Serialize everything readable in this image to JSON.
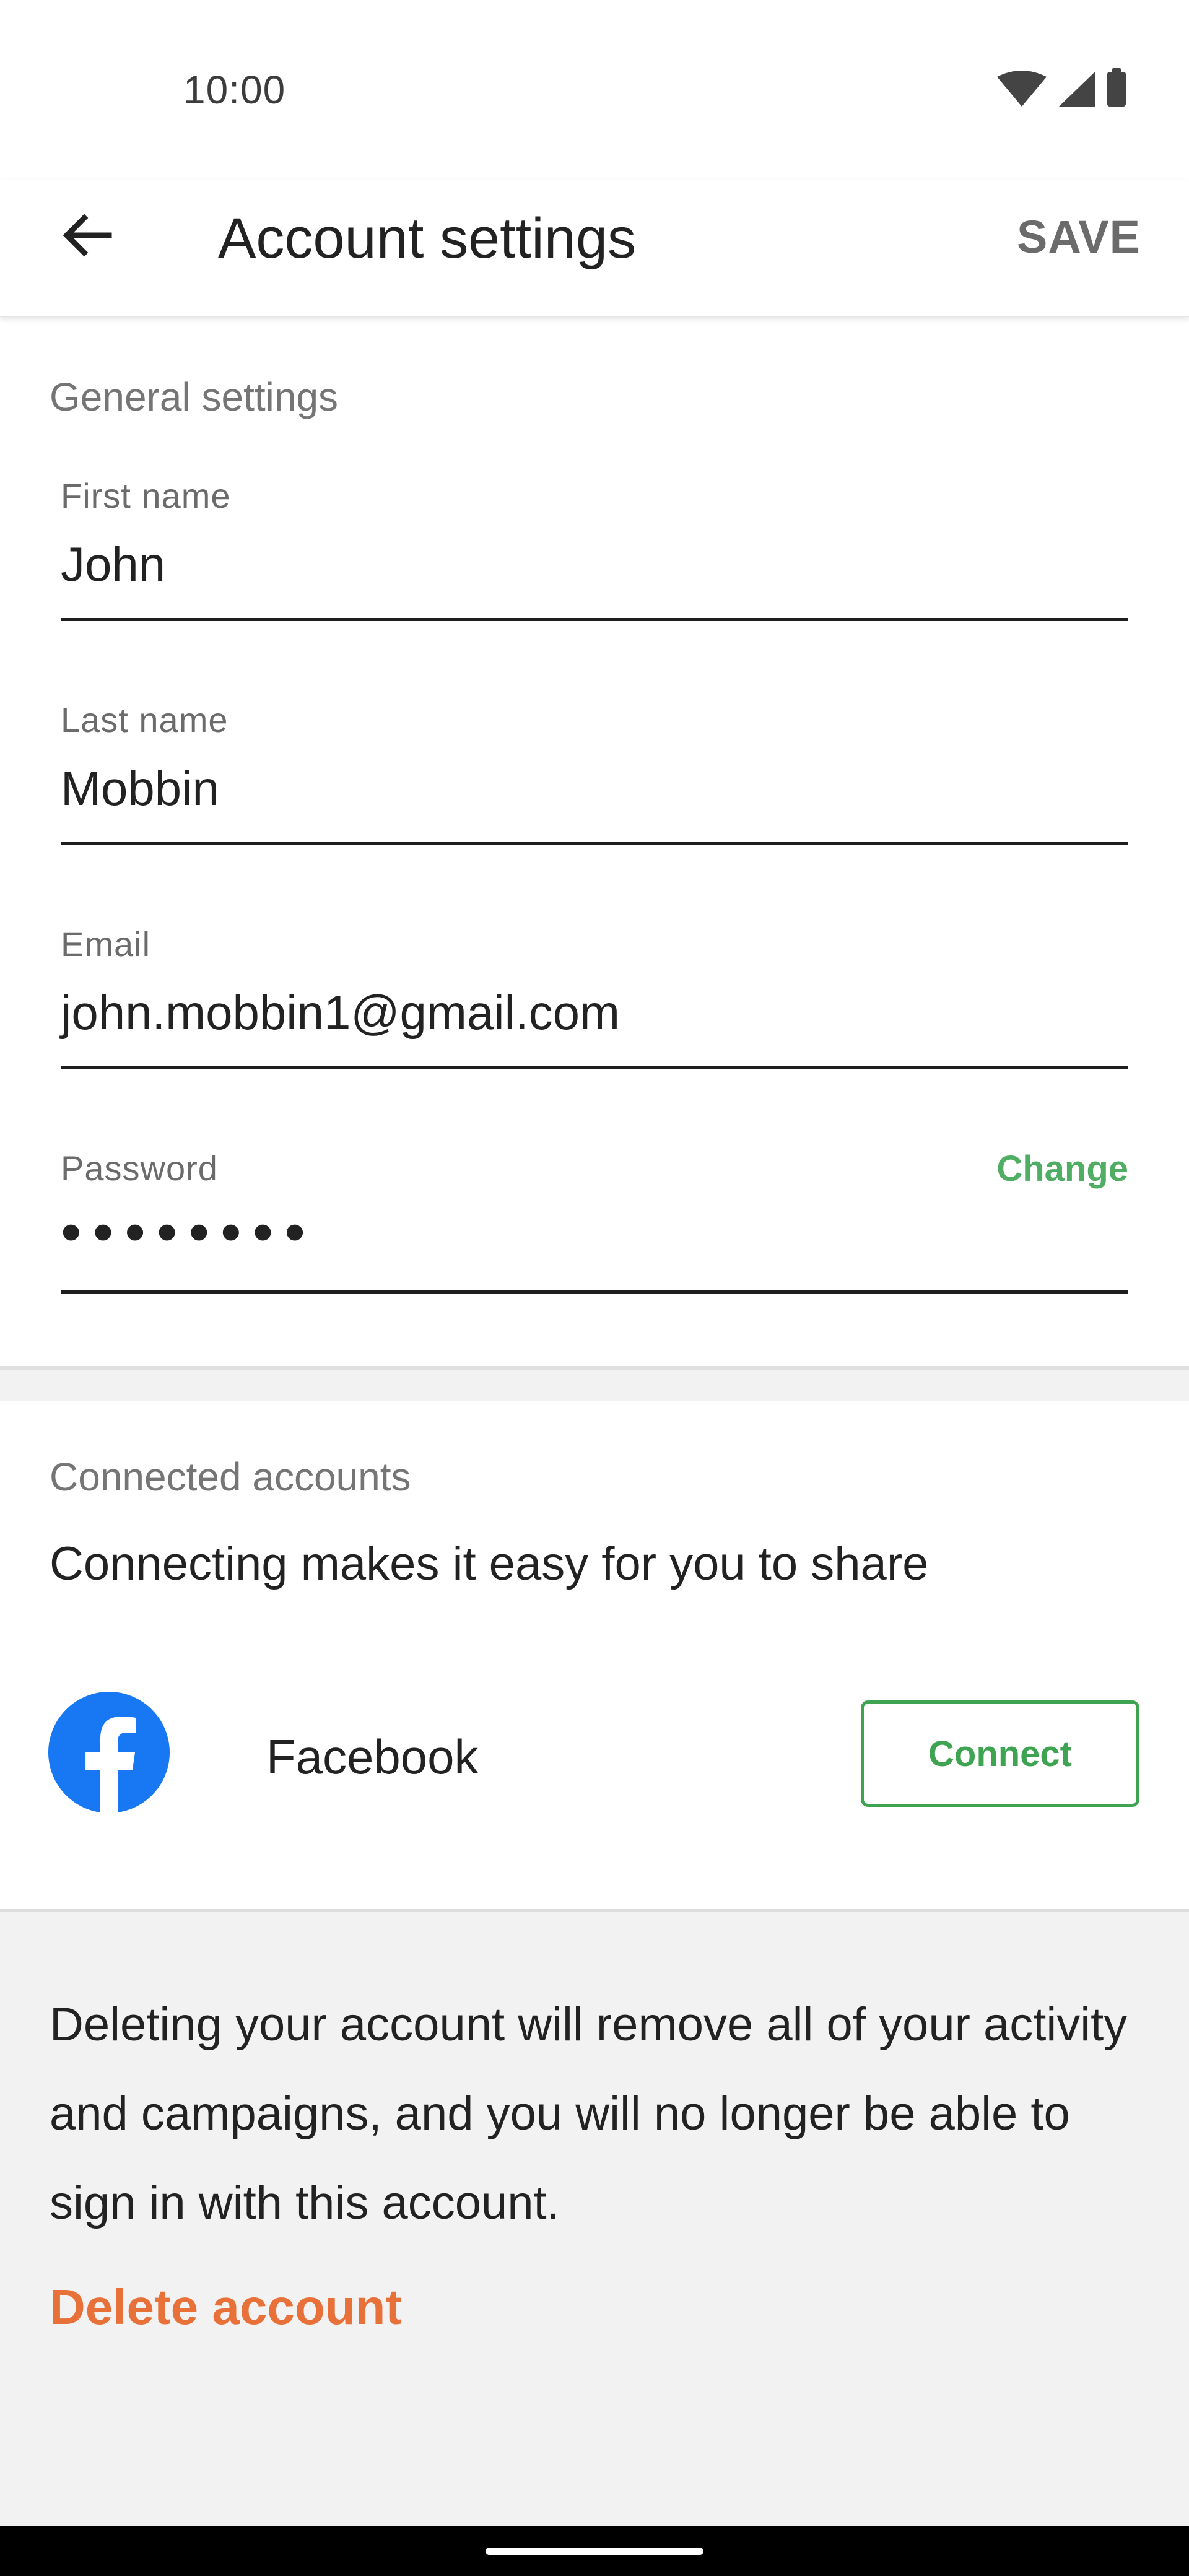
{
  "status_bar": {
    "time": "10:00",
    "icons": [
      "wifi-icon",
      "cellular-signal-icon",
      "battery-icon"
    ]
  },
  "app_bar": {
    "back_icon": "arrow-back-icon",
    "title": "Account settings",
    "save_label": "SAVE"
  },
  "general": {
    "heading": "General settings",
    "fields": {
      "first_name": {
        "label": "First name",
        "value": "John"
      },
      "last_name": {
        "label": "Last name",
        "value": "Mobbin"
      },
      "email": {
        "label": "Email",
        "value": "john.mobbin1@gmail.com"
      },
      "password": {
        "label": "Password",
        "value": "••••••••",
        "action": "Change"
      }
    }
  },
  "connected": {
    "heading": "Connected accounts",
    "description": "Connecting makes it easy for you to share",
    "accounts": [
      {
        "icon": "facebook-icon",
        "name": "Facebook",
        "action": "Connect"
      }
    ]
  },
  "delete": {
    "description": "Deleting your account will remove all of your activity and campaigns, and you will no longer be able to sign in with this account.",
    "action": "Delete account"
  },
  "colors": {
    "accent_green": "#3ea451",
    "delete_orange": "#e8713a",
    "facebook_blue": "#1877f2",
    "save_gray": "#6b6b6b"
  }
}
